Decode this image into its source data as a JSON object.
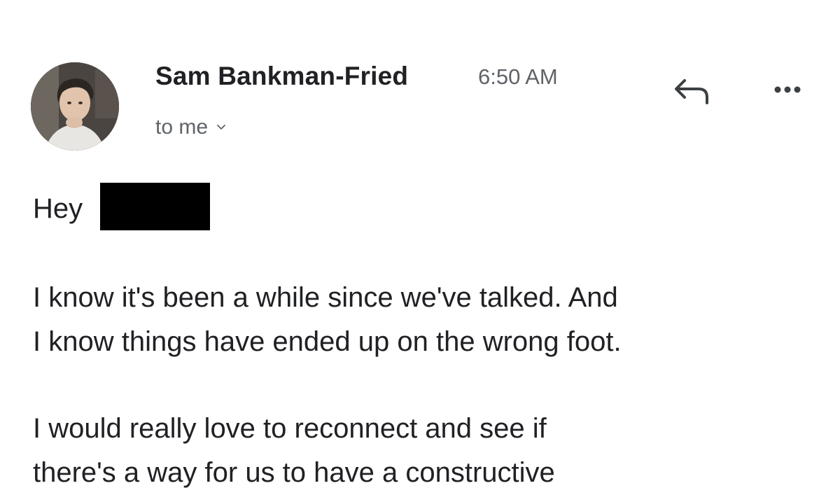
{
  "sender": {
    "name": "Sam Bankman-Fried",
    "time": "6:50 AM",
    "recipient_label": "to me"
  },
  "icons": {
    "reply": "reply-arrow-icon",
    "more": "more-horizontal-icon",
    "recipient_expand": "chevron-down-icon"
  },
  "message": {
    "greeting": "Hey",
    "paragraphs": [
      {
        "lines": [
          "I know it's been a while since we've talked.  And",
          "I know things have ended up on the wrong foot."
        ]
      },
      {
        "lines": [
          "I would really love to reconnect and see if",
          "there's a way for us to have a constructive"
        ]
      }
    ]
  },
  "colors": {
    "text_primary": "#202124",
    "text_secondary": "#5f6368",
    "redaction": "#000000"
  }
}
